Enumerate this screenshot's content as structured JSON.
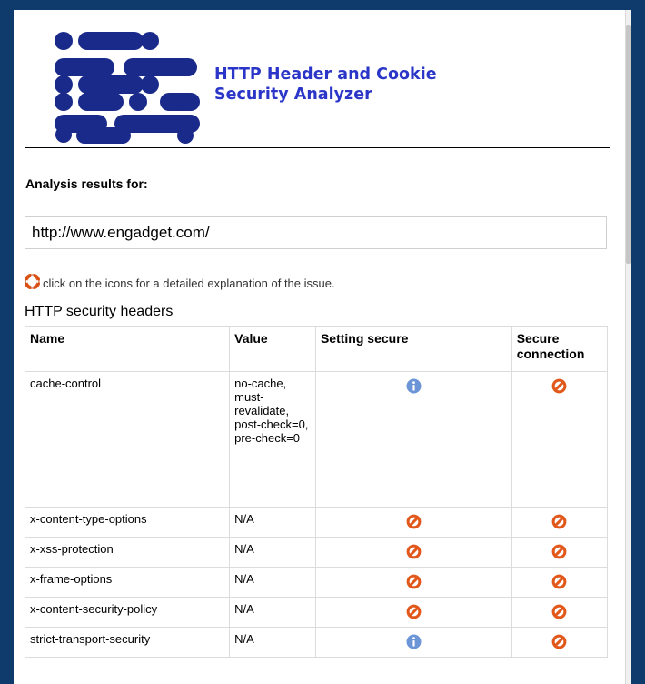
{
  "app": {
    "title_line1": "HTTP Header and Cookie",
    "title_line2": "Security Analyzer",
    "logo": "hcsa-logo"
  },
  "analysis": {
    "heading": "Analysis results for:",
    "url": "http://www.engadget.com/"
  },
  "hint": {
    "icon": "lifebuoy-icon",
    "text": "click on the icons for a detailed explanation of the issue."
  },
  "headers_section": {
    "title": "HTTP security headers",
    "columns": [
      "Name",
      "Value",
      "Setting secure",
      "Secure\nconnection"
    ],
    "rows": [
      {
        "name": "cache-control",
        "value": "no-cache, must-revalidate, post-check=0, pre-check=0",
        "setting_secure": "info",
        "secure_connection": "insecure"
      },
      {
        "name": "x-content-type-options",
        "value": "N/A",
        "setting_secure": "insecure",
        "secure_connection": "insecure"
      },
      {
        "name": "x-xss-protection",
        "value": "N/A",
        "setting_secure": "insecure",
        "secure_connection": "insecure"
      },
      {
        "name": "x-frame-options",
        "value": "N/A",
        "setting_secure": "insecure",
        "secure_connection": "insecure"
      },
      {
        "name": "x-content-security-policy",
        "value": "N/A",
        "setting_secure": "insecure",
        "secure_connection": "insecure"
      },
      {
        "name": "strict-transport-security",
        "value": "N/A",
        "setting_secure": "info",
        "secure_connection": "insecure"
      }
    ]
  },
  "colors": {
    "background": "#0e3a6c",
    "title_blue": "#2b36c8",
    "logo_navy": "#1a2a8a",
    "no_icon": "#e2571a",
    "info_icon": "#6c95d8"
  }
}
